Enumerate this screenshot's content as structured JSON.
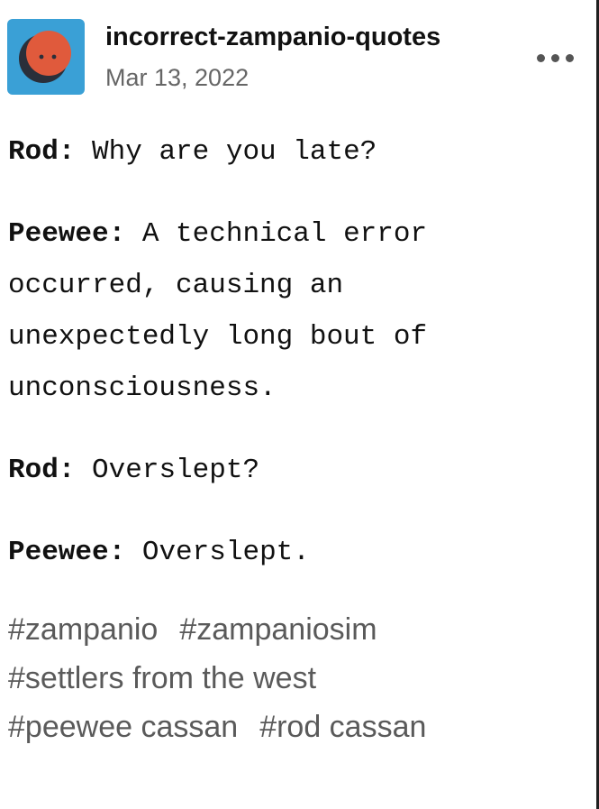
{
  "header": {
    "blog_name": "incorrect-zampanio-quotes",
    "date": "Mar 13, 2022",
    "avatar_icon": "orange-face-icon",
    "more_icon": "ellipsis-icon"
  },
  "post": {
    "dialogue": [
      {
        "speaker": "Rod:",
        "lines": [
          "Why are you late?"
        ]
      },
      {
        "speaker": "Peewee:",
        "lines": [
          "A technical error",
          "occurred, causing an",
          "unexpectedly long bout of",
          "unconsciousness."
        ]
      },
      {
        "speaker": "Rod:",
        "lines": [
          "Overslept?"
        ]
      },
      {
        "speaker": "Peewee:",
        "lines": [
          "Overslept."
        ]
      }
    ]
  },
  "tags": [
    "#zampanio",
    "#zampaniosim",
    "#settlers from the west",
    "#peewee cassan",
    "#rod cassan"
  ],
  "colors": {
    "avatar_bg": "#3aa0d6",
    "avatar_face": "#e05a3c",
    "tag_text": "#5a5a5a",
    "date_text": "#666666"
  }
}
